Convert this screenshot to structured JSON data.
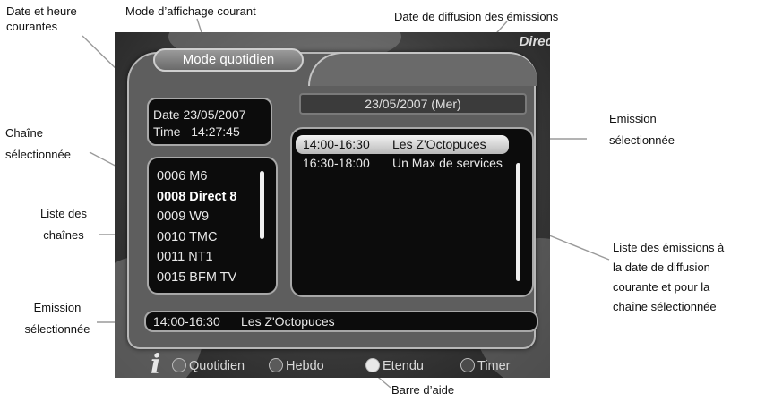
{
  "annotations": {
    "date_time": [
      "Date et heure",
      "courantes"
    ],
    "display_mode": "Mode d’affichage courant",
    "broadcast_date": "Date de diffusion des émissions",
    "selected_channel": [
      "Chaîne",
      "sélectionnée"
    ],
    "channel_list": [
      "Liste des",
      "chaînes"
    ],
    "selected_program_top": [
      "Emission",
      "sélectionnée"
    ],
    "program_list": [
      "Liste des émissions à",
      "la date de diffusion",
      "courante et pour la",
      "chaîne sélectionnée"
    ],
    "selected_program_bottom": [
      "Emission",
      "sélectionnée"
    ],
    "help_bar": "Barre d’aide"
  },
  "screen": {
    "mode_label": "Mode quotidien",
    "date_line": "Date 23/05/2007",
    "time_line": "Time   14:27:45",
    "broadcast_date": "23/05/2007 (Mer)",
    "channels": [
      {
        "number": "0006",
        "name": "M6"
      },
      {
        "number": "0008",
        "name": "Direct 8"
      },
      {
        "number": "0009",
        "name": "W9"
      },
      {
        "number": "0010",
        "name": "TMC"
      },
      {
        "number": "0011",
        "name": "NT1"
      },
      {
        "number": "0015",
        "name": "BFM TV"
      }
    ],
    "selected_channel_index": 1,
    "programs": [
      {
        "time": "14:00-16:30",
        "title": "Les Z'Octopuces"
      },
      {
        "time": "16:30-18:00",
        "title": "Un Max de services"
      }
    ],
    "selected_program_index": 0,
    "info_bar": {
      "time": "14:00-16:30",
      "title": "Les Z'Octopuces"
    },
    "background_logo": "Direct"
  },
  "help_bar": {
    "icon": "info-icon",
    "icon_glyph": "i",
    "buttons": [
      {
        "label": "Quotidien",
        "color": "#6a6a6a"
      },
      {
        "label": "Hebdo",
        "color": "#5a5a5a"
      },
      {
        "label": "Etendu",
        "color": "#e8e8e8"
      },
      {
        "label": "Timer",
        "color": "#4a4a4a"
      }
    ]
  }
}
